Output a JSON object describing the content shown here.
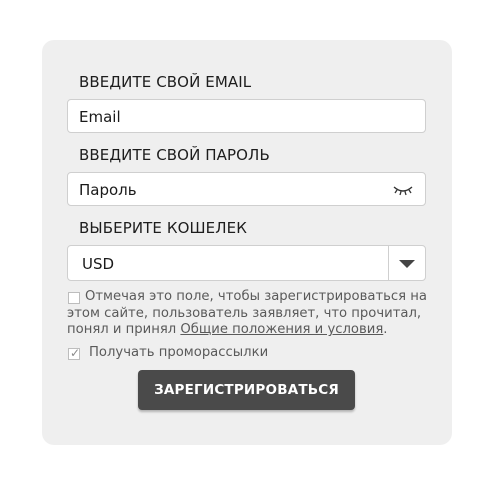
{
  "form": {
    "email_label": "ВВЕДИТЕ СВОЙ EMAIL",
    "email_placeholder": "Email",
    "password_label": "ВВЕДИТЕ СВОЙ ПАРОЛЬ",
    "password_placeholder": "Пароль",
    "wallet_label": "ВЫБЕРИТЕ КОШЕЛЕК",
    "wallet_selected": "USD",
    "terms_text": "Отмечая это поле, чтобы зарегистрироваться на этом сайте, пользователь заявляет, что прочитал, понял и принял ",
    "terms_link": "Общие положения и условия",
    "terms_end": ".",
    "terms_checked": false,
    "promo_label": "Получать проморассылки",
    "promo_checked": true,
    "submit_label": "ЗАРЕГИСТРИРОВАТЬСЯ"
  },
  "icons": {
    "password_toggle": "eye-closed-icon",
    "wallet_dropdown": "chevron-down-icon"
  },
  "colors": {
    "panel_bg": "#efefef",
    "button_bg": "#4a4a4a"
  }
}
